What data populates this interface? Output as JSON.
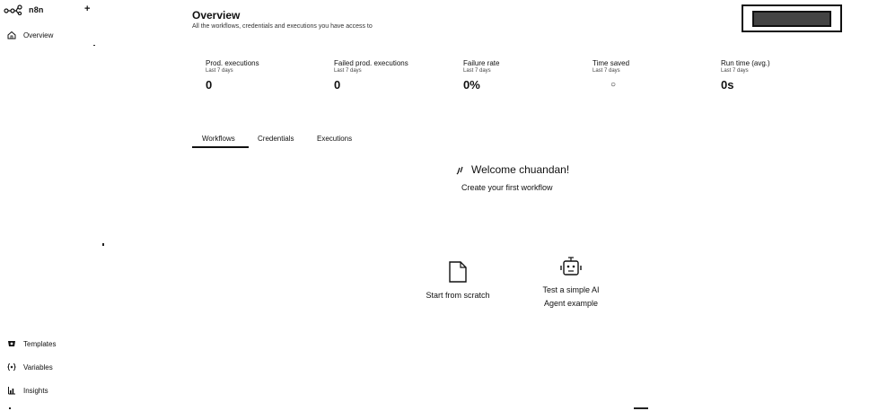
{
  "sidebar": {
    "brand_name": "n8n",
    "add_label": "+",
    "nav_top": [
      {
        "label": "Overview",
        "icon": "home-icon"
      }
    ],
    "nav_bottom": [
      {
        "label": "Templates",
        "icon": "templates-icon"
      },
      {
        "label": "Variables",
        "icon": "variables-icon"
      },
      {
        "label": "Insights",
        "icon": "insights-icon"
      }
    ]
  },
  "header": {
    "title": "Overview",
    "subtitle": "All the workflows, credentials and executions you have access to"
  },
  "stats": [
    {
      "label": "Prod. executions",
      "period": "Last 7 days",
      "value": "0"
    },
    {
      "label": "Failed prod. executions",
      "period": "Last 7 days",
      "value": "0"
    },
    {
      "label": "Failure rate",
      "period": "Last 7 days",
      "value": "0%"
    },
    {
      "label": "Time saved",
      "period": "Last 7 days",
      "value": "○"
    },
    {
      "label": "Run time (avg.)",
      "period": "Last 7 days",
      "value": "0s"
    }
  ],
  "tabs": [
    {
      "label": "Workflows",
      "active": true
    },
    {
      "label": "Credentials",
      "active": false
    },
    {
      "label": "Executions",
      "active": false
    }
  ],
  "welcome": {
    "title": "Welcome chuandan!",
    "subtitle": "Create your first workflow"
  },
  "cards": [
    {
      "label": "Start from scratch",
      "icon": "file-icon"
    },
    {
      "label_line1": "Test a simple AI",
      "label_line2": "Agent example",
      "icon": "robot-icon"
    }
  ],
  "colors": {
    "text": "#111111",
    "background": "#ffffff",
    "accent": "#111111"
  }
}
